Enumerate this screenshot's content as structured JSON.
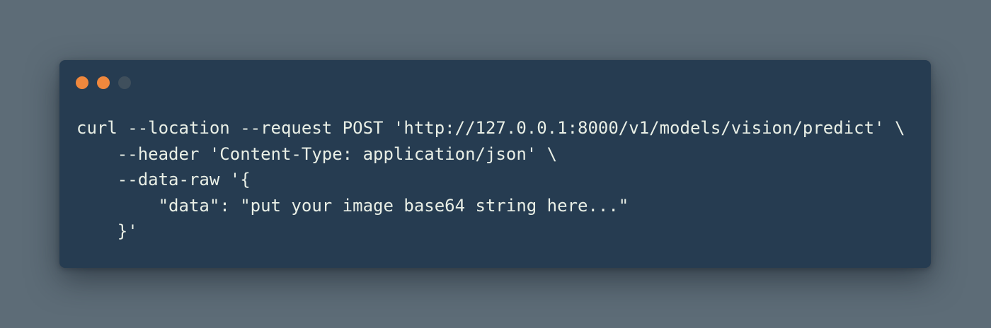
{
  "window": {
    "controls": [
      {
        "name": "close",
        "color": "#f0883d"
      },
      {
        "name": "minimize",
        "color": "#f0883d"
      },
      {
        "name": "maximize",
        "color": "#3f4f5c"
      }
    ]
  },
  "code": {
    "lines": [
      "curl --location --request POST 'http://127.0.0.1:8000/v1/models/vision/predict' \\",
      "    --header 'Content-Type: application/json' \\",
      "    --data-raw '{",
      "        \"data\": \"put your image base64 string here...\"",
      "    }'"
    ]
  },
  "colors": {
    "background": "#5d6c77",
    "panel": "#263c51",
    "text": "#e9efe6"
  }
}
